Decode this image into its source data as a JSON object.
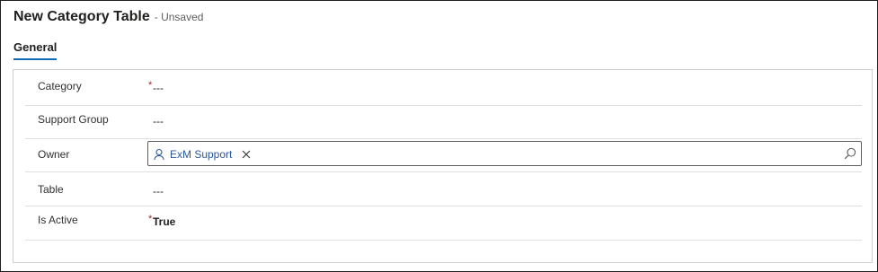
{
  "header": {
    "title": "New Category Table",
    "status": "- Unsaved"
  },
  "tabs": [
    {
      "label": "General",
      "selected": true
    }
  ],
  "form": {
    "required_marker": "*",
    "fields": [
      {
        "label": "Category",
        "required": true,
        "value": "---"
      },
      {
        "label": "Support Group",
        "required": false,
        "value": "---"
      },
      {
        "label": "Owner",
        "required": true,
        "lookup_value": "ExM Support"
      },
      {
        "label": "Table",
        "required": false,
        "value": "---"
      },
      {
        "label": "Is Active",
        "required": true,
        "value": "True"
      }
    ]
  },
  "icons": {
    "owner_tag": "person-icon",
    "owner_remove": "close-icon",
    "lookup_search": "search-icon"
  },
  "colors": {
    "accent": "#0f6cbd",
    "required": "#a4262c",
    "lookup_text": "#2b5797"
  }
}
